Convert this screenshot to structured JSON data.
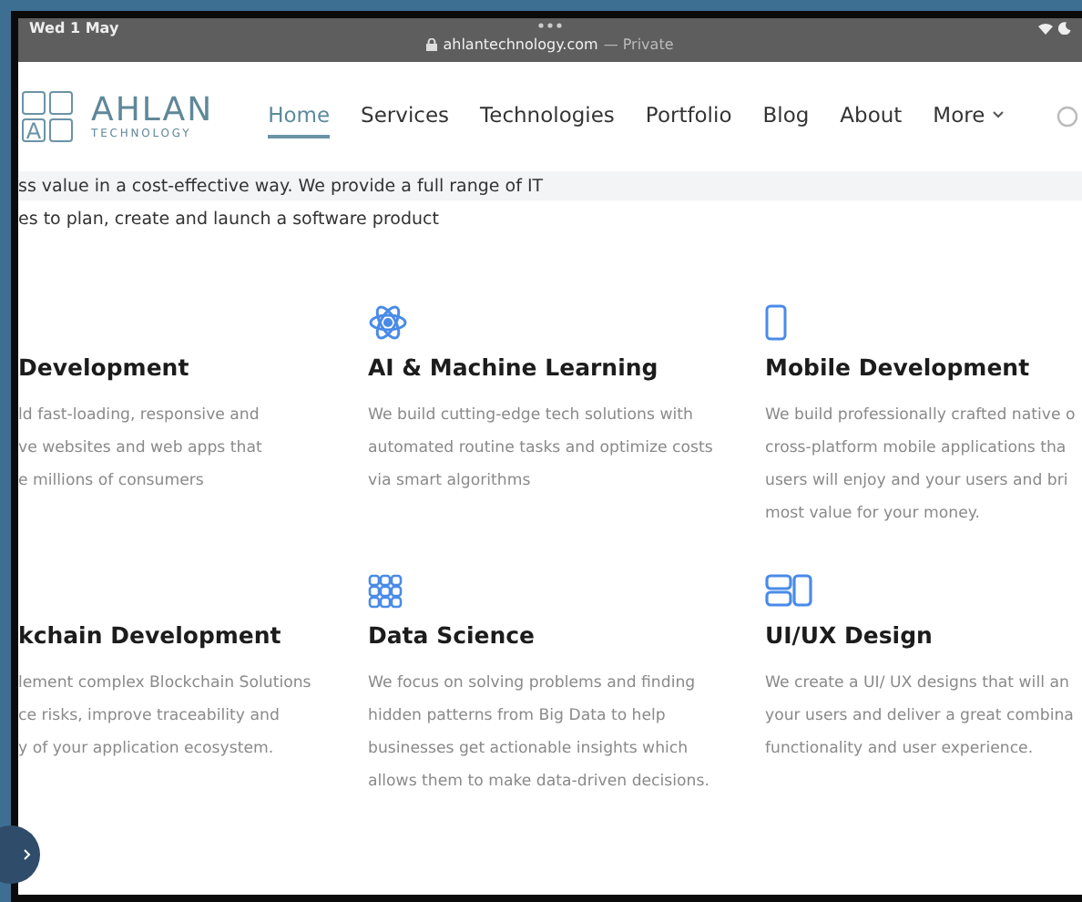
{
  "status_bar": {
    "time": "Wed 1 May",
    "url": "ahlantechnology.com",
    "privacy": "— Private"
  },
  "nav": {
    "logo": {
      "mark": "A",
      "name": "AHLAN",
      "tagline": "TECHNOLOGY"
    },
    "items": [
      {
        "label": "Home",
        "selected": true,
        "kind": "link"
      },
      {
        "label": "Services",
        "selected": false,
        "kind": "link"
      },
      {
        "label": "Technologies",
        "selected": false,
        "kind": "link"
      },
      {
        "label": "Portfolio",
        "selected": false,
        "kind": "link"
      },
      {
        "label": "Blog",
        "selected": false,
        "kind": "link"
      },
      {
        "label": "About",
        "selected": false,
        "kind": "link"
      },
      {
        "label": "More",
        "selected": false,
        "kind": "dropdown"
      }
    ]
  },
  "intro": {
    "lines": [
      "ss value in a cost-effective way. We provide a full range of IT",
      "es to plan, create and launch a software product"
    ]
  },
  "services": [
    {
      "title": "Development",
      "lines": [
        "ld fast-loading, responsive and",
        "ve websites and web apps that",
        "e millions of consumers"
      ]
    },
    {
      "title": "AI & Machine Learning",
      "lines": [
        "We build cutting-edge tech solutions with",
        "automated routine tasks and optimize costs",
        "via smart algorithms"
      ]
    },
    {
      "title": "Mobile Development",
      "lines": [
        "We build professionally crafted native o",
        "cross-platform mobile applications tha",
        "users will enjoy and your users and bri",
        "most value for your money."
      ]
    },
    {
      "title": "kchain Development",
      "lines": [
        "lement complex Blockchain Solutions",
        "ce risks, improve traceability and",
        "y of your application ecosystem."
      ]
    },
    {
      "title": "Data Science",
      "lines": [
        "We focus on solving problems and finding",
        "hidden patterns from Big Data to help",
        "businesses get actionable insights which",
        "allows them to make data-driven decisions."
      ]
    },
    {
      "title": "UI/UX Design",
      "lines": [
        "We create a UI/ UX designs that will an",
        "your users and deliver a great combina",
        "functionality and user experience."
      ]
    }
  ]
}
